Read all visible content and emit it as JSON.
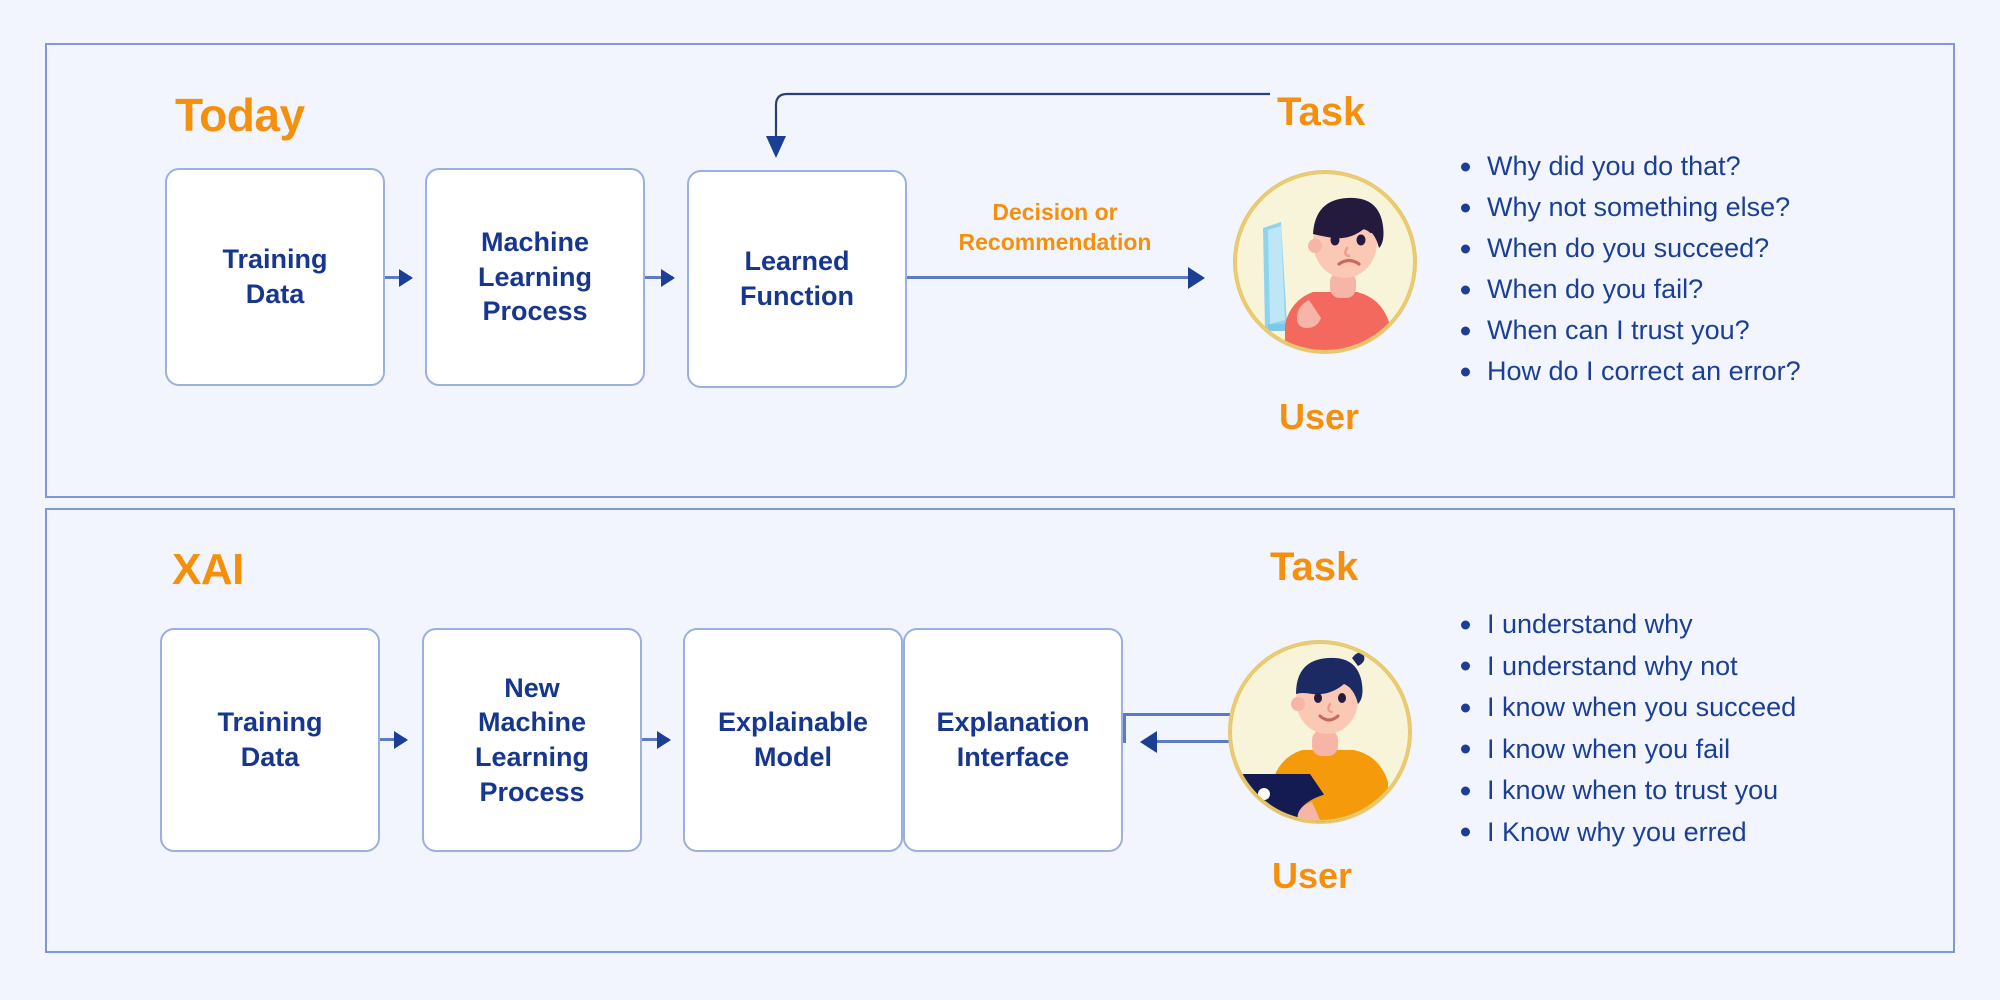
{
  "colors": {
    "background": "#f2f5fd",
    "panel_border": "#8098d4",
    "box_border": "#9bb0de",
    "box_fill": "#ffffff",
    "accent_orange": "#f5900d",
    "text_blue": "#17378f",
    "arrow_blue": "#1c3f96",
    "line_blue": "#5b7bc4",
    "avatar_circle": "#f8f4d9",
    "avatar_ring": "#e8c86b"
  },
  "panels": [
    {
      "id": "today",
      "title": "Today",
      "task_label": "Task",
      "user_label": "User",
      "boxes": [
        {
          "label": "Training\nData",
          "lines": [
            "Training",
            "Data"
          ]
        },
        {
          "label": "Machine Learning Process",
          "lines": [
            "Machine",
            "Learning",
            "Process"
          ]
        },
        {
          "label": "Learned Function",
          "lines": [
            "Learned",
            "Function"
          ]
        }
      ],
      "edge_label": {
        "lines": [
          "Decision or",
          "Recommendation"
        ]
      },
      "questions": [
        "Why did you do that?",
        "Why not something else?",
        "When do you succeed?",
        "When do you fail?",
        "When can I trust you?",
        "How do I correct an error?"
      ]
    },
    {
      "id": "xai",
      "title": "XAI",
      "task_label": "Task",
      "user_label": "User",
      "boxes": [
        {
          "label": "Training Data",
          "lines": [
            "Training",
            "Data"
          ]
        },
        {
          "label": "New Machine Learning Process",
          "lines": [
            "New",
            "Machine",
            "Learning",
            "Process"
          ]
        },
        {
          "label": "Explainable Model",
          "lines": [
            "Explainable",
            "Model"
          ]
        },
        {
          "label": "Explanation Interface",
          "lines": [
            "Explanation",
            "Interface"
          ]
        }
      ],
      "questions": [
        "I understand why",
        "I understand why not",
        "I know when you succeed",
        "I know when you fail",
        "I know when to trust you",
        "I Know why you erred"
      ]
    }
  ],
  "box_text": {
    "training_data_1_l1": "Training",
    "training_data_1_l2": "Data",
    "ml_process_l1": "Machine",
    "ml_process_l2": "Learning",
    "ml_process_l3": "Process",
    "learned_function_l1": "Learned",
    "learned_function_l2": "Function",
    "training_data_2_l1": "Training",
    "training_data_2_l2": "Data",
    "new_ml_process_l1": "New",
    "new_ml_process_l2": "Machine",
    "new_ml_process_l3": "Learning",
    "new_ml_process_l4": "Process",
    "explainable_model_l1": "Explainable",
    "explainable_model_l2": "Model",
    "explanation_interface_l1": "Explanation",
    "explanation_interface_l2": "Interface"
  },
  "edge_labels": {
    "decision_l1": "Decision or",
    "decision_l2": "Recommendation"
  }
}
